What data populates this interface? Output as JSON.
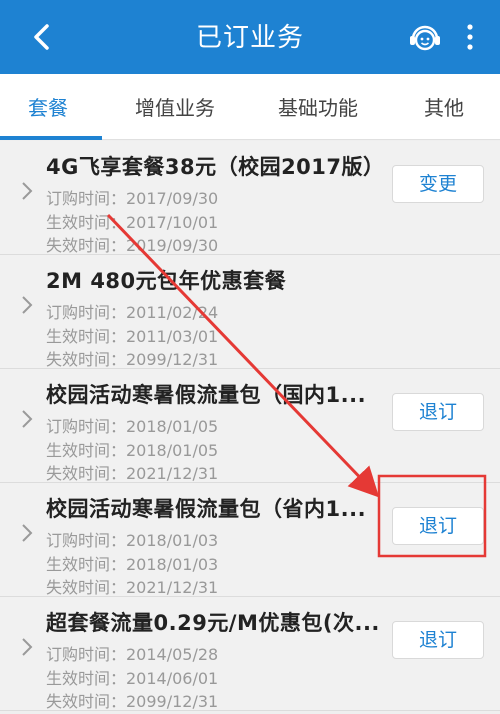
{
  "header": {
    "title": "已订业务",
    "back_icon": "chevron-left-icon",
    "service_icon": "customer-service-icon",
    "more_icon": "vertical-dots-icon",
    "background": "#1e82d2"
  },
  "tabs": [
    {
      "label": "套餐",
      "active": true
    },
    {
      "label": "增值业务",
      "active": false
    },
    {
      "label": "基础功能",
      "active": false
    },
    {
      "label": "其他",
      "active": false
    }
  ],
  "items": [
    {
      "title": "4G飞享套餐38元（校园2017版）",
      "order_time": "订购时间：2017/09/30",
      "effective_time": "生效时间：2017/10/01",
      "expire_time": "失效时间：2019/09/30",
      "action": "变更"
    },
    {
      "title": "2M 480元包年优惠套餐",
      "order_time": "订购时间：2011/02/24",
      "effective_time": "生效时间：2011/03/01",
      "expire_time": "失效时间：2099/12/31",
      "action": ""
    },
    {
      "title": "校园活动寒暑假流量包（国内1...",
      "order_time": "订购时间：2018/01/05",
      "effective_time": "生效时间：2018/01/05",
      "expire_time": "失效时间：2021/12/31",
      "action": "退订"
    },
    {
      "title": "校园活动寒暑假流量包（省内1...",
      "order_time": "订购时间：2018/01/03",
      "effective_time": "生效时间：2018/01/03",
      "expire_time": "失效时间：2021/12/31",
      "action": "退订"
    },
    {
      "title": "超套餐流量0.29元/M优惠包(次...",
      "order_time": "订购时间：2014/05/28",
      "effective_time": "生效时间：2014/06/01",
      "expire_time": "失效时间：2099/12/31",
      "action": "退订"
    }
  ],
  "annotation": {
    "color": "#e53935"
  }
}
